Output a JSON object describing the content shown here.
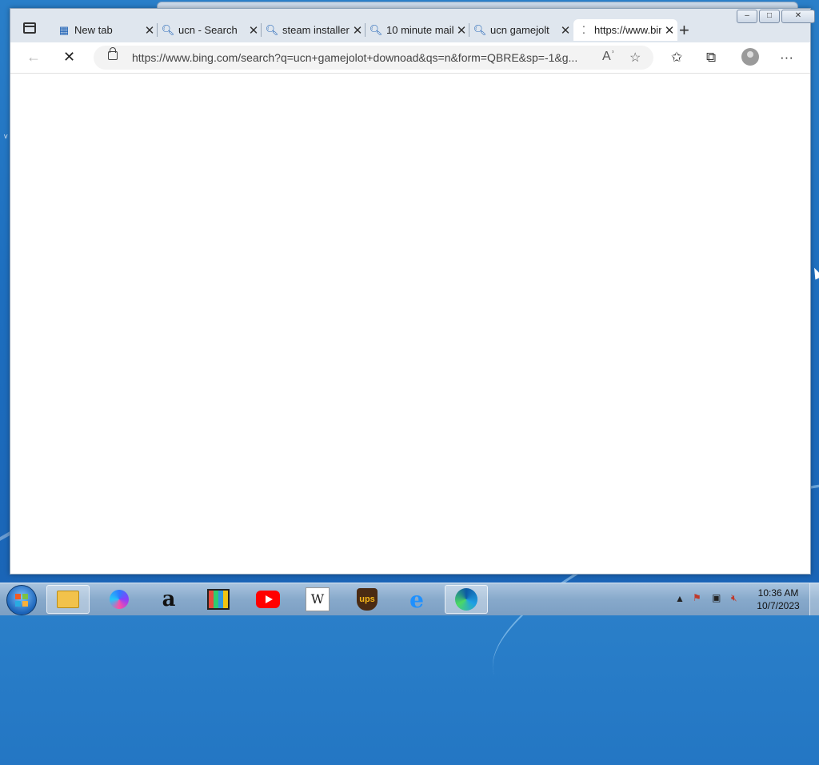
{
  "browser": {
    "tabs": [
      {
        "title": "New tab",
        "icon": "newtab-icon"
      },
      {
        "title": "ucn - Search",
        "icon": "search-icon"
      },
      {
        "title": "steam installer",
        "icon": "search-icon"
      },
      {
        "title": "10 minute mail",
        "icon": "search-icon"
      },
      {
        "title": "ucn gamejolt",
        "icon": "search-icon"
      },
      {
        "title": "https://www.bing.com",
        "icon": "loading-icon",
        "active": true
      }
    ],
    "address_url": "https://www.bing.com/search?q=ucn+gamejolot+downoad&qs=n&form=QBRE&sp=-1&g...",
    "read_aloud_glyph": "Aʾ",
    "window_controls": {
      "minimize": "–",
      "maximize": "□",
      "close": "✕"
    }
  },
  "taskbar": {
    "apps": [
      "explorer",
      "copilot",
      "amazon",
      "store",
      "youtube",
      "wikipedia",
      "ups",
      "internet-explorer",
      "edge"
    ],
    "amazon_glyph": "a",
    "wiki_glyph": "W",
    "ups_glyph": "ups",
    "ie_glyph": "e",
    "clock_time": "10:36 AM",
    "clock_date": "10/7/2023"
  },
  "desktop": {
    "edge_char": "v"
  }
}
